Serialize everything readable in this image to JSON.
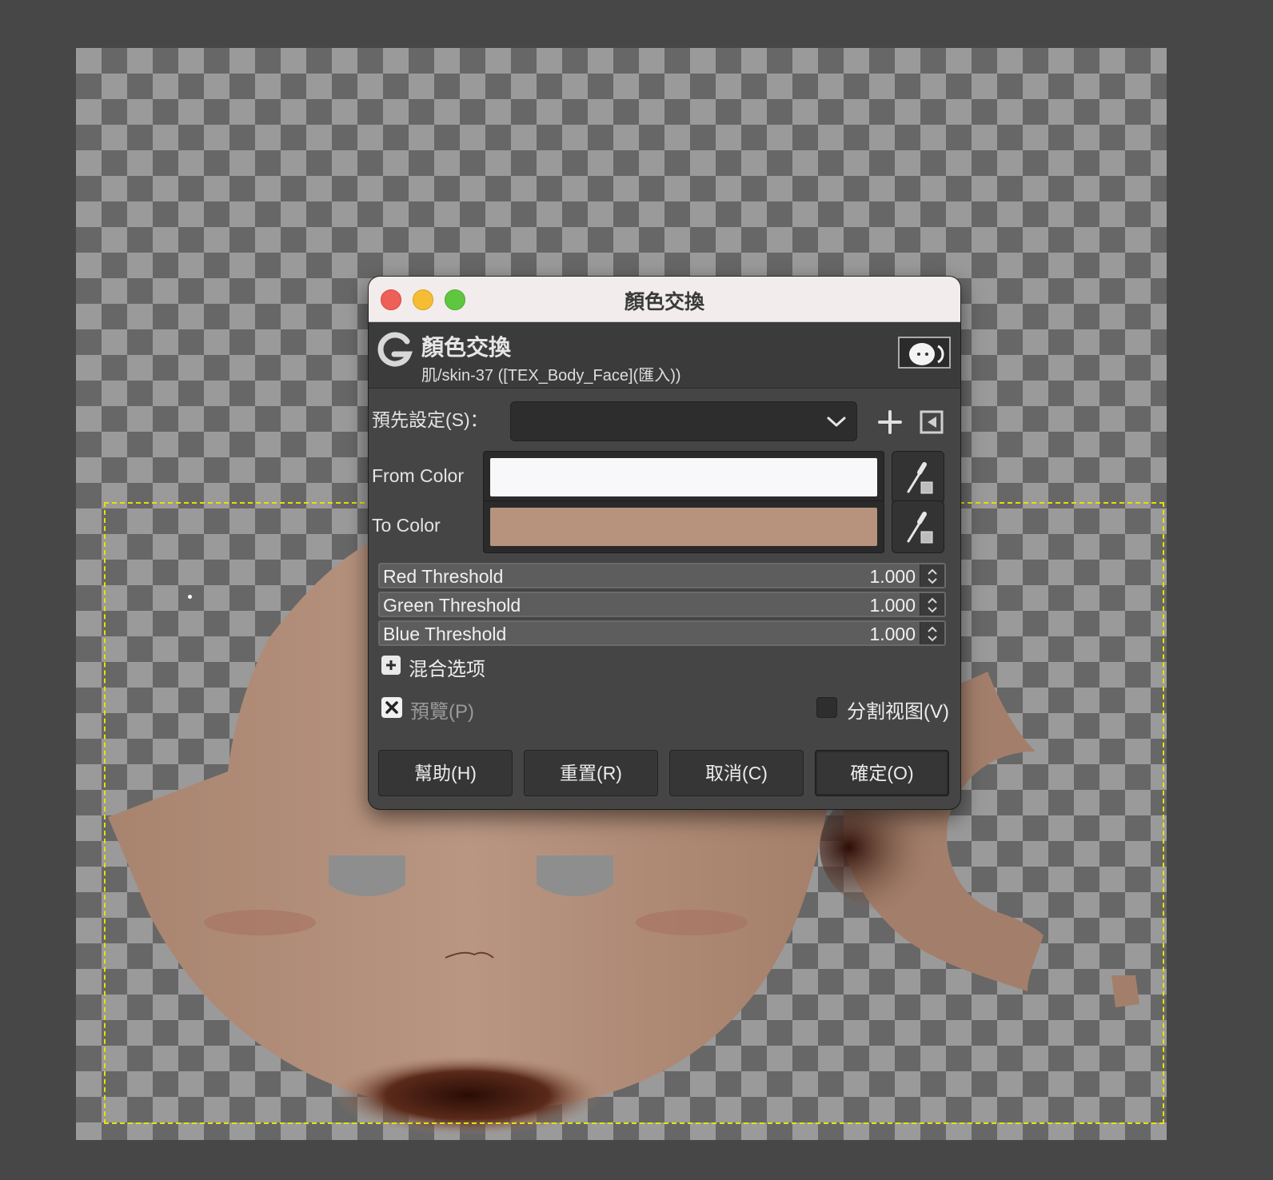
{
  "dialog": {
    "window_title": "顏色交換",
    "header_title": "顏色交換",
    "header_subtitle": "肌/skin-37 ([TEX_Body_Face](匯入))",
    "preset_label": "預先設定(S)：",
    "preset_value": "",
    "from_color_label": "From Color",
    "from_color": "#f8f8fb",
    "to_color_label": "To Color",
    "to_color": "#b7937e",
    "thresholds": [
      {
        "label": "Red Threshold",
        "value": "1.000"
      },
      {
        "label": "Green Threshold",
        "value": "1.000"
      },
      {
        "label": "Blue Threshold",
        "value": "1.000"
      }
    ],
    "blend_options_label": "混合选项",
    "preview_label": "預覽(P)",
    "preview_checked": true,
    "split_view_label": "分割视图(V)",
    "split_view_checked": false,
    "buttons": {
      "help": "幫助(H)",
      "reset": "重置(R)",
      "cancel": "取消(C)",
      "ok": "確定(O)"
    }
  },
  "colors": {
    "skin": "#b7937e",
    "canvas_bg": "#474747"
  }
}
